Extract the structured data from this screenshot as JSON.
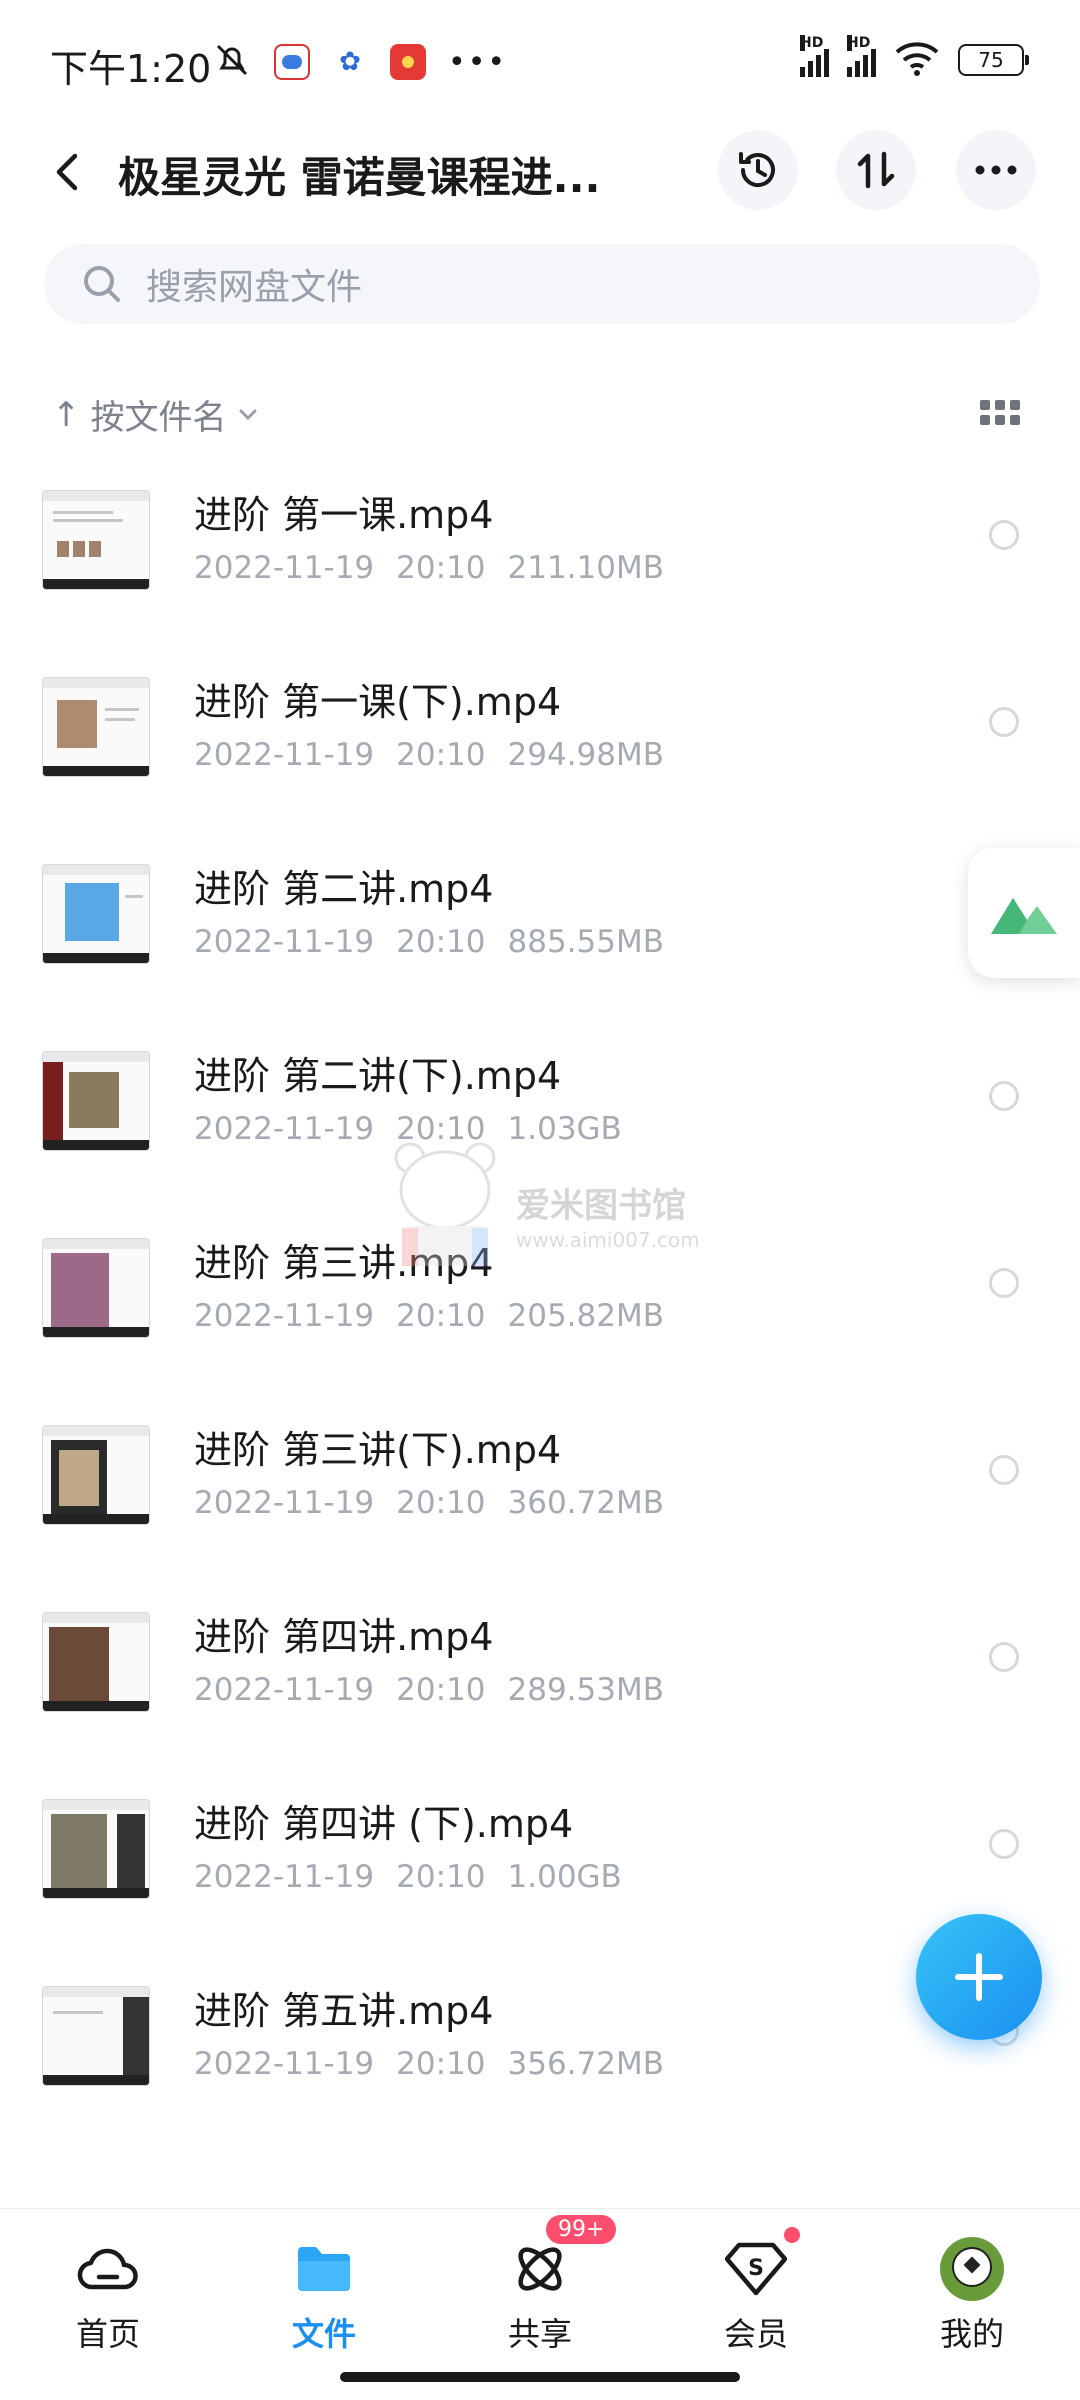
{
  "status_bar": {
    "time": "下午1:20",
    "battery": "75",
    "hd_label": "HD"
  },
  "header": {
    "title": "极星灵光 雷诺曼课程进...",
    "icons": [
      "back-icon",
      "history-icon",
      "sort-transfer-icon",
      "more-icon"
    ]
  },
  "search": {
    "placeholder": "搜索网盘文件"
  },
  "sort": {
    "label": "按文件名",
    "arrow": "↑"
  },
  "files": [
    {
      "name": "进阶 第一课.mp4",
      "date": "2022-11-19",
      "time": "20:10",
      "size": "211.10MB"
    },
    {
      "name": "进阶 第一课(下).mp4",
      "date": "2022-11-19",
      "time": "20:10",
      "size": "294.98MB"
    },
    {
      "name": "进阶 第二讲.mp4",
      "date": "2022-11-19",
      "time": "20:10",
      "size": "885.55MB"
    },
    {
      "name": "进阶 第二讲(下).mp4",
      "date": "2022-11-19",
      "time": "20:10",
      "size": "1.03GB"
    },
    {
      "name": "进阶 第三讲.mp4",
      "date": "2022-11-19",
      "time": "20:10",
      "size": "205.82MB"
    },
    {
      "name": "进阶 第三讲(下).mp4",
      "date": "2022-11-19",
      "time": "20:10",
      "size": "360.72MB"
    },
    {
      "name": "进阶 第四讲.mp4",
      "date": "2022-11-19",
      "time": "20:10",
      "size": "289.53MB"
    },
    {
      "name": "进阶 第四讲 (下).mp4",
      "date": "2022-11-19",
      "time": "20:10",
      "size": "1.00GB"
    },
    {
      "name": "进阶 第五讲.mp4",
      "date": "2022-11-19",
      "time": "20:10",
      "size": "356.72MB"
    }
  ],
  "watermark": {
    "title": "爱米图书馆",
    "url": "www.aimi007.com"
  },
  "bottom_nav": {
    "items": [
      {
        "label": "首页",
        "icon": "cloud-icon",
        "active": false
      },
      {
        "label": "文件",
        "icon": "folder-icon",
        "active": true
      },
      {
        "label": "共享",
        "icon": "atom-icon",
        "active": false,
        "badge": "99+"
      },
      {
        "label": "会员",
        "icon": "vip-diamond-icon",
        "active": false
      },
      {
        "label": "我的",
        "icon": "avatar-icon",
        "active": false
      }
    ]
  },
  "colors": {
    "accent": "#1a8ff0",
    "badge": "#ff4d6d",
    "meta_text": "#a6aab2"
  }
}
